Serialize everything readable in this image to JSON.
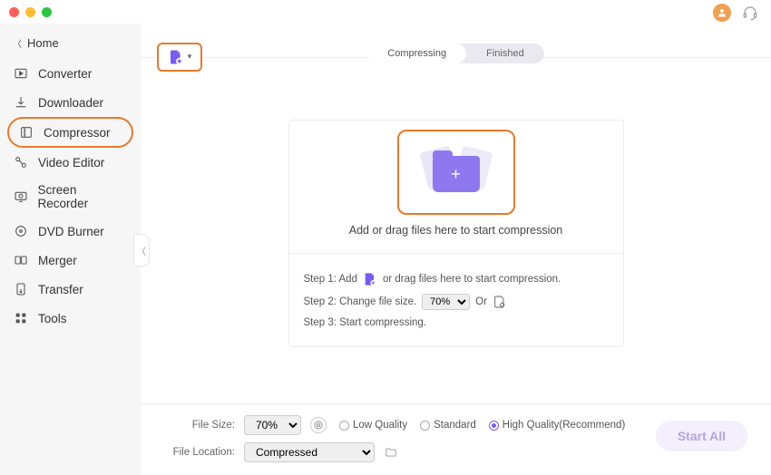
{
  "sidebar": {
    "home": "Home",
    "items": [
      {
        "id": "converter",
        "label": "Converter"
      },
      {
        "id": "downloader",
        "label": "Downloader"
      },
      {
        "id": "compressor",
        "label": "Compressor"
      },
      {
        "id": "video-editor",
        "label": "Video Editor"
      },
      {
        "id": "screen-recorder",
        "label": "Screen Recorder"
      },
      {
        "id": "dvd-burner",
        "label": "DVD Burner"
      },
      {
        "id": "merger",
        "label": "Merger"
      },
      {
        "id": "transfer",
        "label": "Transfer"
      },
      {
        "id": "tools",
        "label": "Tools"
      }
    ],
    "active_id": "compressor"
  },
  "tabs": {
    "compressing": "Compressing",
    "finished": "Finished",
    "active": "compressing"
  },
  "dropzone": {
    "caption": "Add or drag files here to start compression"
  },
  "steps": {
    "step1_prefix": "Step 1: Add",
    "step1_suffix": "or drag files here to start compression.",
    "step2_prefix": "Step 2: Change file size.",
    "step2_or": "Or",
    "step2_value": "70%",
    "step3": "Step 3: Start compressing."
  },
  "footer": {
    "file_size_label": "File Size:",
    "file_size_value": "70%",
    "file_location_label": "File Location:",
    "file_location_value": "Compressed",
    "quality": {
      "low": "Low Quality",
      "standard": "Standard",
      "high": "High Quality(Recommend)",
      "selected": "high"
    },
    "start_all": "Start All"
  }
}
